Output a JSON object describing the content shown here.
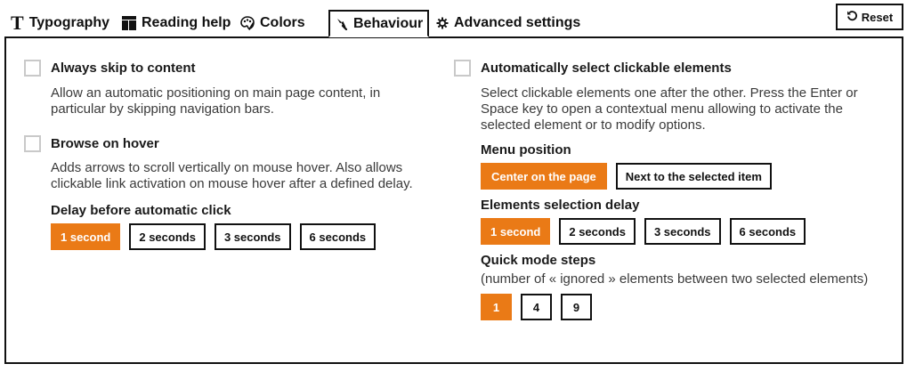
{
  "tabs": [
    {
      "label": "Typography",
      "icon": "T"
    },
    {
      "label": "Reading help",
      "icon": "reading-help-icon"
    },
    {
      "label": "Colors",
      "icon": "palette-icon"
    },
    {
      "label": "Behaviour",
      "icon": "pointer-icon",
      "active": true
    },
    {
      "label": "Advanced settings",
      "icon": "gear-icon"
    }
  ],
  "reset_label": "Reset",
  "accent_color": "#ea7a16",
  "left": {
    "skip": {
      "title": "Always skip to content",
      "desc": "Allow an automatic positioning on main page content, in particular by skipping navigation bars."
    },
    "hover": {
      "title": "Browse on hover",
      "desc": "Adds arrows to scroll vertically on mouse hover. Also allows clickable link activation on mouse hover after a defined delay."
    },
    "delay": {
      "title": "Delay before automatic click",
      "options": [
        "1 second",
        "2 seconds",
        "3 seconds",
        "6 seconds"
      ],
      "selected": "1 second"
    }
  },
  "right": {
    "autoselect": {
      "title": "Automatically select clickable elements",
      "desc": "Select clickable elements one after the other. Press the Enter or Space key to open a contextual menu allowing to activate the selected element or to modify options."
    },
    "menu_position": {
      "title": "Menu position",
      "options": [
        "Center on the page",
        "Next to the selected item"
      ],
      "selected": "Center on the page"
    },
    "selection_delay": {
      "title": "Elements selection delay",
      "options": [
        "1 second",
        "2 seconds",
        "3 seconds",
        "6 seconds"
      ],
      "selected": "1 second"
    },
    "quick_mode": {
      "title": "Quick mode steps",
      "desc": "(number of « ignored » elements between two selected elements)",
      "options": [
        "1",
        "4",
        "9"
      ],
      "selected": "1"
    }
  }
}
